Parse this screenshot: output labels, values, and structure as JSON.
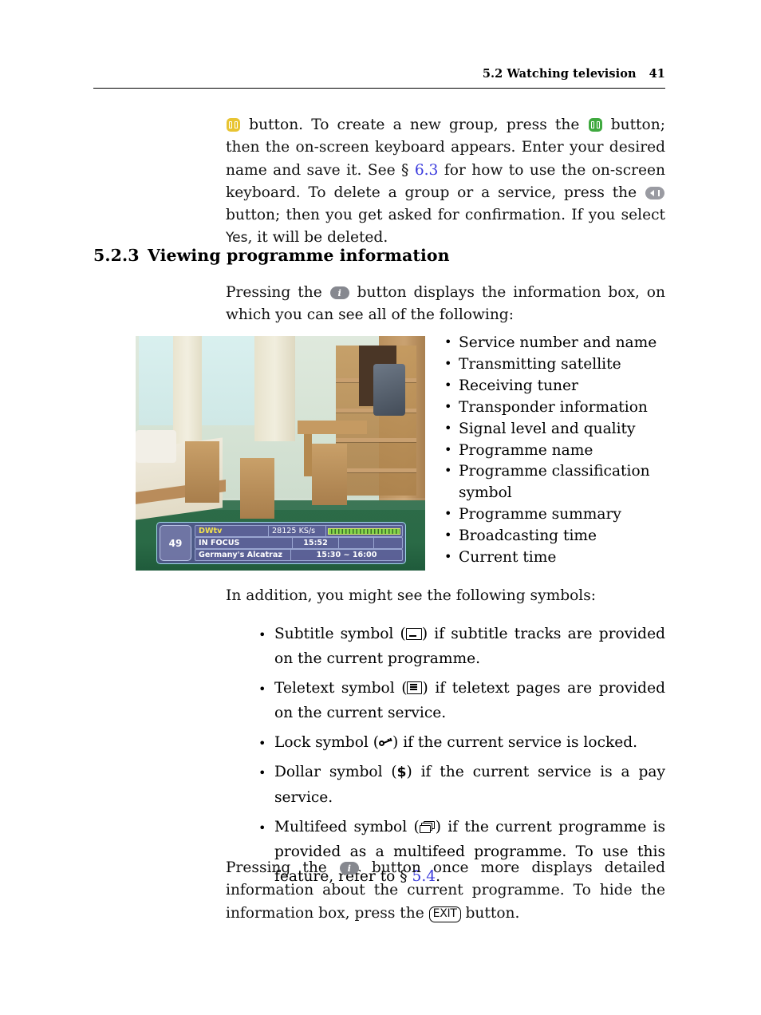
{
  "header": {
    "section_title": "5.2 Watching television",
    "page_number": "41"
  },
  "paragraph_group": {
    "p1_a": "button.  To create a new group, press the",
    "p1_b": "button; then the on-screen keyboard appears. Enter your desired name and save it.  See §",
    "p1_xref": "6.3",
    "p1_c": "for how to use the on-screen keyboard.  To delete a group or a service, press the",
    "p1_d": "button; then you get asked for confirmation. If you select",
    "p1_yes": "Yes",
    "p1_e": ", it will be deleted."
  },
  "section": {
    "number": "5.2.3",
    "title": "Viewing programme information"
  },
  "intro": {
    "a": "Pressing the",
    "b": "button displays the information box, on which you can see all of the following:"
  },
  "feature_list": [
    "Service number and name",
    "Transmitting satellite",
    "Receiving tuner",
    "Transponder information",
    "Signal level and quality",
    "Programme name",
    "Programme classification symbol",
    "Programme summary",
    "Broadcasting time",
    "Current time"
  ],
  "figure": {
    "caption_none": "",
    "osd": {
      "channel_number": "49",
      "service_name": "DWtv",
      "symbol_rate": "28125 KS/s",
      "programme_name": "IN FOCUS",
      "current_time": "15:52",
      "programme_summary": "Germany's Alcatraz",
      "broadcast_time": "15:30 ~ 16:00"
    }
  },
  "symbols_intro": "In addition, you might see the following symbols:",
  "symbol_list": [
    {
      "lead": "Subtitle symbol (",
      "icon": "subtitle-icon",
      "tail": ") if subtitle tracks are provided on the current programme."
    },
    {
      "lead": "Teletext symbol (",
      "icon": "teletext-icon",
      "tail": ") if teletext pages are provided on the current service."
    },
    {
      "lead": "Lock symbol (",
      "icon": "lock-icon",
      "tail": ") if the current service is locked."
    },
    {
      "lead": "Dollar symbol (",
      "icon": "dollar-icon",
      "icon_text": "$",
      "tail": ") if the current service is a pay service."
    },
    {
      "lead": "Multifeed symbol (",
      "icon": "multifeed-icon",
      "tail_a": ") if the current programme is provided as a multifeed programme.  To use this feature, refer to §",
      "xref": "5.4",
      "tail_b": "."
    }
  ],
  "closing": {
    "a": "Pressing the",
    "b": "button once more displays detailed information about the current programme.  To hide the information box, press the",
    "key": "EXIT",
    "c": "button."
  },
  "colors": {
    "yellow_button": "#e8c432",
    "green_button": "#3fa93f",
    "grey_button": "#9a9ba2",
    "xref_link": "#3b3bdd",
    "osd_background": "#565696",
    "osd_border": "#9fd8e8",
    "osd_service_text": "#f3e24c"
  }
}
